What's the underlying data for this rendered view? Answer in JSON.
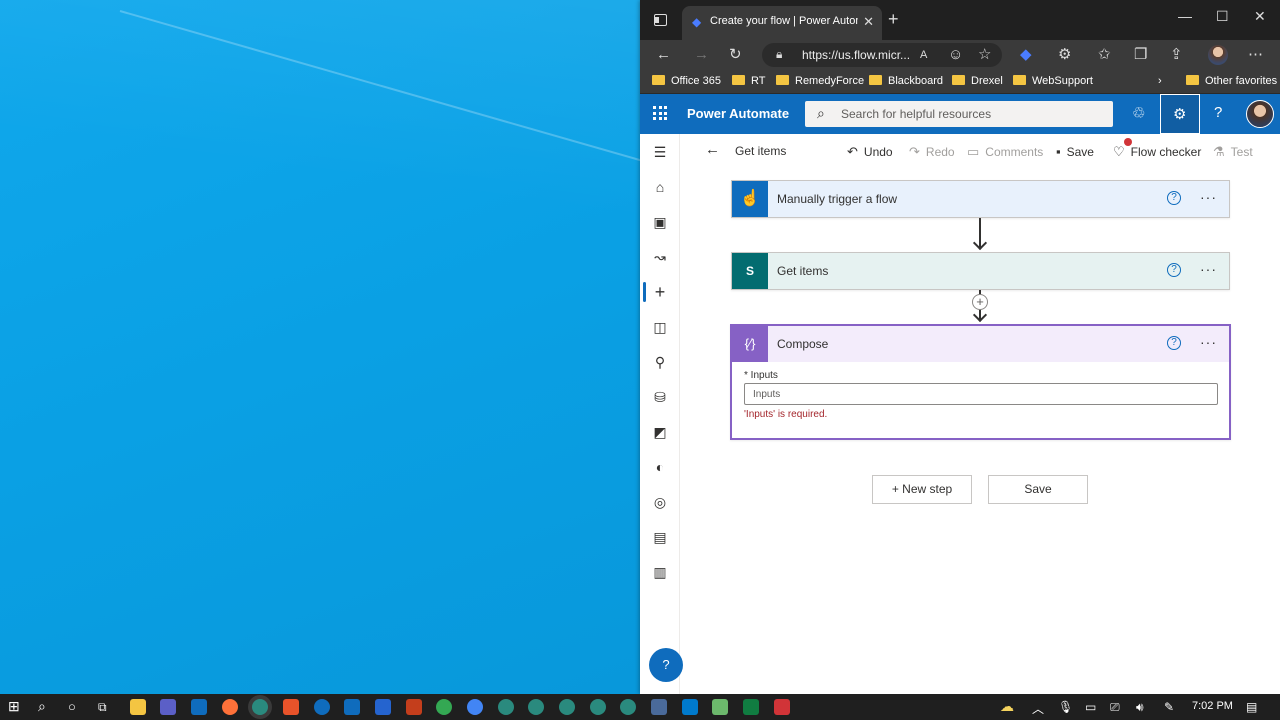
{
  "browser": {
    "tab_title": "Create your flow | Power Automate",
    "url": "https://us.flow.micr...",
    "favorites": [
      "Office 365",
      "RT",
      "RemedyForce",
      "Blackboard",
      "Drexel",
      "WebSupport"
    ],
    "other_favorites": "Other favorites"
  },
  "app": {
    "title": "Power Automate",
    "search_placeholder": "Search for helpful resources"
  },
  "cmdbar": {
    "back_title": "Get items",
    "undo": "Undo",
    "redo": "Redo",
    "comments": "Comments",
    "save": "Save",
    "flow_checker": "Flow checker",
    "test": "Test"
  },
  "flow": {
    "steps": [
      {
        "title": "Manually trigger a flow",
        "color": "#0f6cbd"
      },
      {
        "title": "Get items",
        "color": "#036c70"
      },
      {
        "title": "Compose",
        "color": "#8661c5"
      }
    ],
    "compose": {
      "field_label": "* Inputs",
      "field_placeholder": "Inputs",
      "error": "'Inputs' is required."
    },
    "new_step": "+ New step",
    "save": "Save"
  },
  "taskbar": {
    "time": "7:02 PM"
  }
}
